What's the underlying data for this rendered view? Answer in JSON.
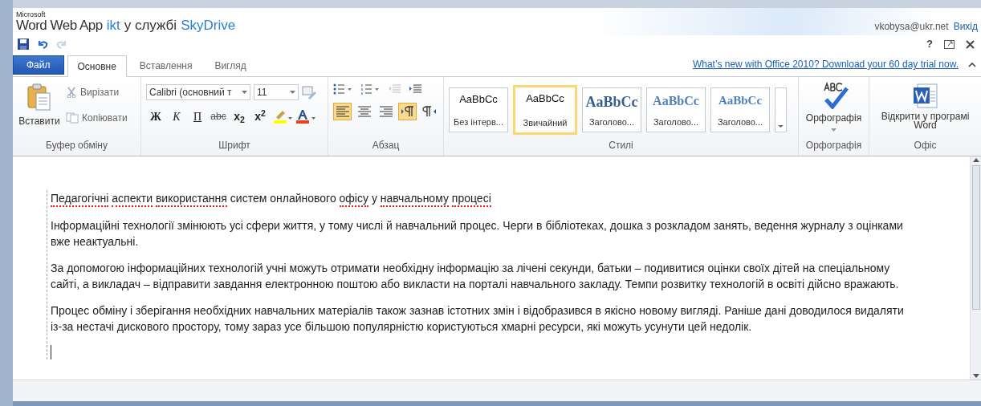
{
  "header": {
    "brand_small": "Microsoft",
    "app_name": "Word Web App",
    "folder": "ikt",
    "separator": "у службі",
    "service": "SkyDrive",
    "user": "vkobysa@ukr.net",
    "sign_out": "Вихід",
    "help": "?"
  },
  "tabs": [
    {
      "label": "Файл",
      "kind": "file",
      "selected": false
    },
    {
      "label": "Основне",
      "kind": "tab",
      "selected": true
    },
    {
      "label": "Вставлення",
      "kind": "tab",
      "selected": false
    },
    {
      "label": "Вигляд",
      "kind": "tab",
      "selected": false
    }
  ],
  "promo_link": "What’s new with Office 2010? Download your 60 day trial now.",
  "ribbon": {
    "clipboard": {
      "paste": "Вставити",
      "cut": "Вирізати",
      "copy": "Копіювати",
      "label": "Буфер обміну"
    },
    "font": {
      "family": "Calibri (основний т",
      "size": "11",
      "buttons": [
        "Ж",
        "К",
        "П",
        "abc",
        "x$_{2}$",
        "x$^{2}$"
      ],
      "label": "Шрифт"
    },
    "paragraph": {
      "align": [
        {
          "kind": "left",
          "selected": true
        },
        {
          "kind": "center",
          "selected": false
        },
        {
          "kind": "right",
          "selected": false
        }
      ],
      "direction": [
        {
          "kind": "ltr",
          "selected": true
        },
        {
          "kind": "rtl",
          "selected": false
        }
      ],
      "label": "Абзац"
    },
    "styles": {
      "items": [
        {
          "sample": "AaBbCc",
          "name": "Без інтерв...",
          "kind": "normal",
          "selected": false
        },
        {
          "sample": "AaBbCc",
          "name": "Звичайний",
          "kind": "normal",
          "selected": true
        },
        {
          "sample": "AaBbCc",
          "name": "Заголово...",
          "kind": "heading1",
          "selected": false
        },
        {
          "sample": "AaBbCc",
          "name": "Заголово...",
          "kind": "heading2",
          "selected": false
        },
        {
          "sample": "AaBbCc",
          "name": "Заголово...",
          "kind": "heading3",
          "selected": false
        }
      ],
      "label": "Стилі"
    },
    "spelling": {
      "button": "Орфографія",
      "label": "Орфографія"
    },
    "office": {
      "button": "Відкрити у програмі Word",
      "label": "Офіс"
    }
  },
  "document": {
    "title": [
      {
        "text": "Педагогічні",
        "misspelled": true
      },
      {
        "text": "аспекти",
        "misspelled": true
      },
      {
        "text": "використання",
        "misspelled": true
      },
      {
        "text": "систем",
        "misspelled": false
      },
      {
        "text": "онлайнового",
        "misspelled": false
      },
      {
        "text": "офісу",
        "misspelled": true
      },
      {
        "text": "у",
        "misspelled": false
      },
      {
        "text": "навчальному",
        "misspelled": true
      },
      {
        "text": "процесі",
        "misspelled": true
      }
    ],
    "paragraphs": [
      "Інформаційні технології змінюють усі сфери життя, у тому числі й навчальний процес. Черги в бібліотеках, дошка з розкладом занять, ведення журналу з оцінками вже неактуальні.",
      "За допомогою інформаційних технологій учні можуть отримати необхідну інформацію за лічені секунди, батьки – подивитися оцінки своїх дітей на спеціальному сайті, а викладач – відправити завдання електронною поштою або викласти на порталі навчального закладу. Темпи розвитку технологій в освіті дійсно вражають.",
      "Процес обміну і зберігання необхідних навчальних матеріалів також зазнав істотних змін і відобразився в якісно новому вигляді. Раніше дані доводилося видаляти із-за нестачі дискового простору, тому зараз усе більшою популярністю користуються хмарні ресурси, які можуть усунути цей недолік."
    ]
  }
}
